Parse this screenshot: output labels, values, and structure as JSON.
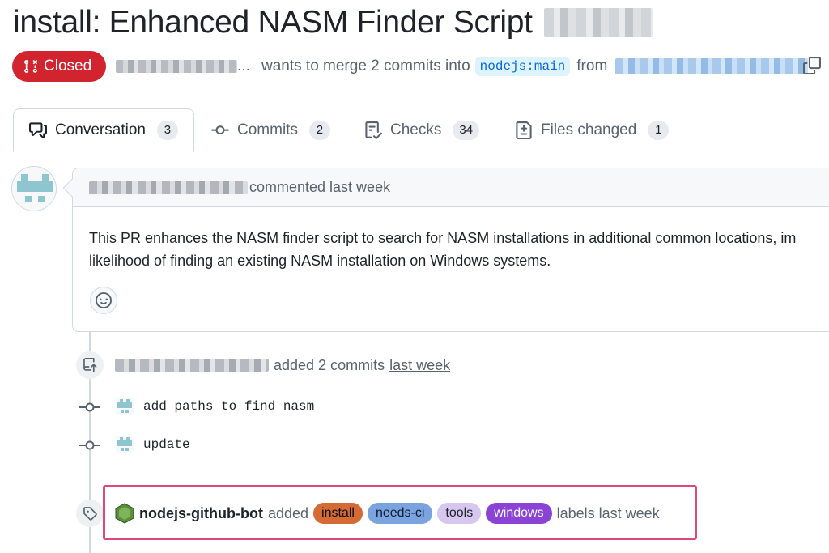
{
  "pr": {
    "title": "install: Enhanced NASM Finder Script",
    "state_label": "Closed",
    "state_color": "#d1242f",
    "author_suffix": "...",
    "merge_text": "wants to merge 2 commits into",
    "base_branch": "nodejs:main",
    "from_text": "from"
  },
  "tabs": [
    {
      "label": "Conversation",
      "count": "3",
      "icon": "comment-discussion-icon"
    },
    {
      "label": "Commits",
      "count": "2",
      "icon": "git-commit-icon"
    },
    {
      "label": "Checks",
      "count": "34",
      "icon": "checklist-icon"
    },
    {
      "label": "Files changed",
      "count": "1",
      "icon": "file-diff-icon"
    }
  ],
  "comment": {
    "header_text": "commented last week",
    "body_line1": "This PR enhances the NASM finder script to search for NASM installations in additional common locations, im",
    "body_line2": "likelihood of finding an existing NASM installation on Windows systems."
  },
  "push_event": {
    "text": "added 2 commits",
    "time": "last week"
  },
  "commits": [
    {
      "message": "add paths to find nasm"
    },
    {
      "message": "update"
    }
  ],
  "label_event": {
    "actor": "nodejs-github-bot",
    "verb": "added",
    "labels": [
      {
        "name": "install",
        "color": "#d66a35"
      },
      {
        "name": "needs-ci",
        "color": "#7aa3df"
      },
      {
        "name": "tools",
        "color": "#d7c7f0"
      },
      {
        "name": "windows",
        "color": "#8b43d6"
      }
    ],
    "tail": "labels last week"
  },
  "highlight_color": "#e0457b"
}
